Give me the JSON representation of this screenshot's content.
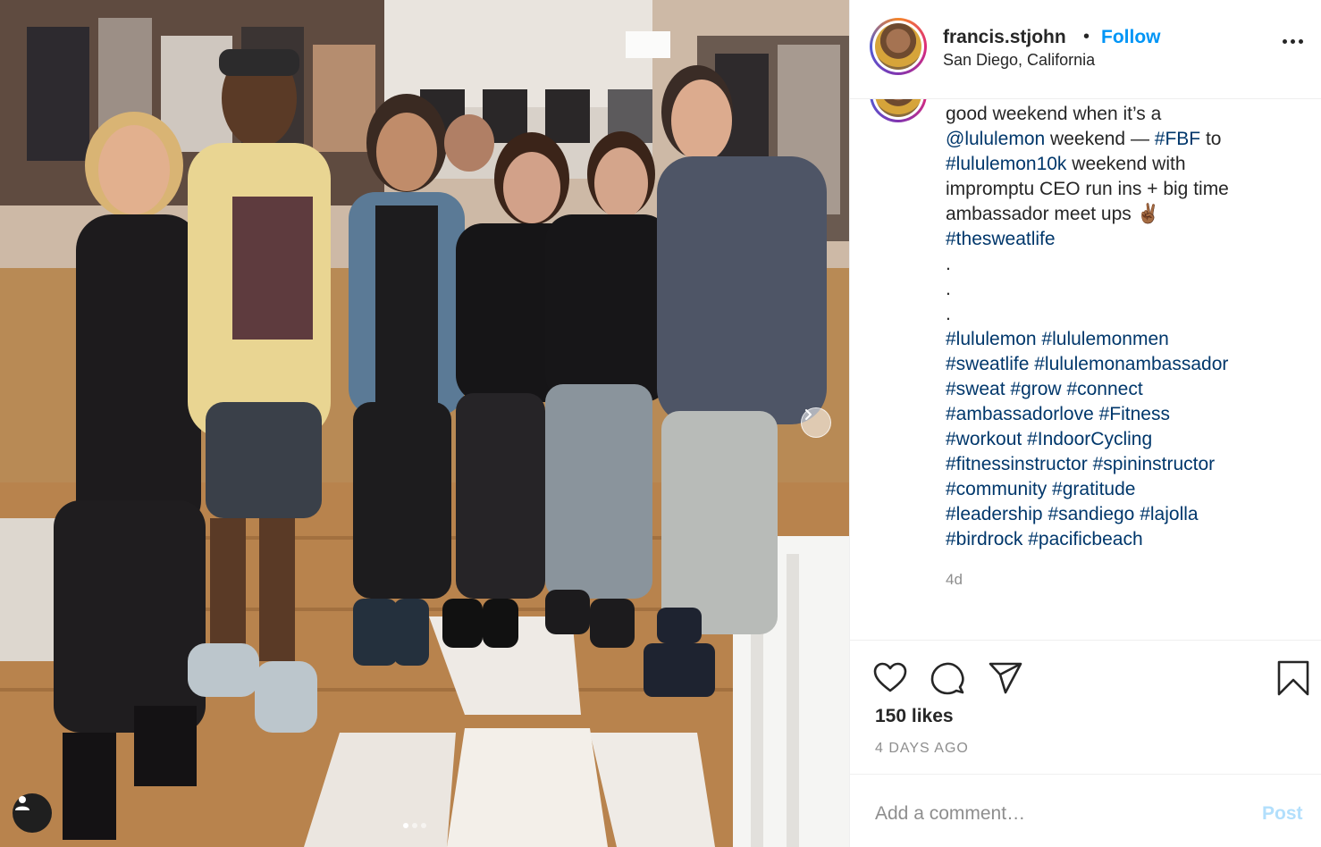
{
  "post": {
    "username": "francis.stjohn",
    "separator": "•",
    "follow_label": "Follow",
    "location": "San Diego, California",
    "caption_segments": [
      {
        "text": "good weekend when it’s a\n",
        "link": false
      },
      {
        "text": "@lululemon",
        "link": true
      },
      {
        "text": " weekend — ",
        "link": false
      },
      {
        "text": "#FBF",
        "link": true
      },
      {
        "text": " to\n",
        "link": false
      },
      {
        "text": "#lululemon10k",
        "link": true
      },
      {
        "text": " weekend with\nimpromptu CEO run ins + big time\nambassador meet ups ✌🏾\n",
        "link": false
      },
      {
        "text": "#thesweatlife",
        "link": true
      },
      {
        "text": "\n.\n.\n.\n",
        "link": false
      },
      {
        "text": "#lululemon",
        "link": true
      },
      {
        "text": " ",
        "link": false
      },
      {
        "text": "#lululemonmen",
        "link": true
      },
      {
        "text": "\n",
        "link": false
      },
      {
        "text": "#sweatlife",
        "link": true
      },
      {
        "text": " ",
        "link": false
      },
      {
        "text": "#lululemonambassador",
        "link": true
      },
      {
        "text": "\n",
        "link": false
      },
      {
        "text": "#sweat",
        "link": true
      },
      {
        "text": " ",
        "link": false
      },
      {
        "text": "#grow",
        "link": true
      },
      {
        "text": " ",
        "link": false
      },
      {
        "text": "#connect",
        "link": true
      },
      {
        "text": "\n",
        "link": false
      },
      {
        "text": "#ambassadorlove",
        "link": true
      },
      {
        "text": " ",
        "link": false
      },
      {
        "text": "#Fitness",
        "link": true
      },
      {
        "text": "\n",
        "link": false
      },
      {
        "text": "#workout",
        "link": true
      },
      {
        "text": " ",
        "link": false
      },
      {
        "text": "#IndoorCycling",
        "link": true
      },
      {
        "text": "\n",
        "link": false
      },
      {
        "text": "#fitnessinstructor",
        "link": true
      },
      {
        "text": " ",
        "link": false
      },
      {
        "text": "#spininstructor",
        "link": true
      },
      {
        "text": "\n",
        "link": false
      },
      {
        "text": "#community",
        "link": true
      },
      {
        "text": " ",
        "link": false
      },
      {
        "text": "#gratitude",
        "link": true
      },
      {
        "text": "\n",
        "link": false
      },
      {
        "text": "#leadership",
        "link": true
      },
      {
        "text": " ",
        "link": false
      },
      {
        "text": "#sandiego",
        "link": true
      },
      {
        "text": " ",
        "link": false
      },
      {
        "text": "#lajolla",
        "link": true
      },
      {
        "text": "\n",
        "link": false
      },
      {
        "text": "#birdrock",
        "link": true
      },
      {
        "text": " ",
        "link": false
      },
      {
        "text": "#pacificbeach",
        "link": true
      }
    ],
    "caption_time": "4d",
    "likes": "150 likes",
    "date": "4 DAYS AGO",
    "comment_placeholder": "Add a comment…",
    "post_label": "Post"
  },
  "carousel": {
    "slide_count": 3,
    "active_index": 0
  },
  "icons": {
    "like": "heart-icon",
    "comment": "comment-bubble-icon",
    "share": "paper-plane-icon",
    "save": "bookmark-icon",
    "more": "ellipsis-icon",
    "user_tag": "user-silhouette-icon",
    "next": "chevron-right-icon"
  },
  "colors": {
    "link": "#00376b",
    "follow": "#0095f6",
    "post_disabled": "#b2dffc",
    "muted": "#8e8e8e"
  }
}
